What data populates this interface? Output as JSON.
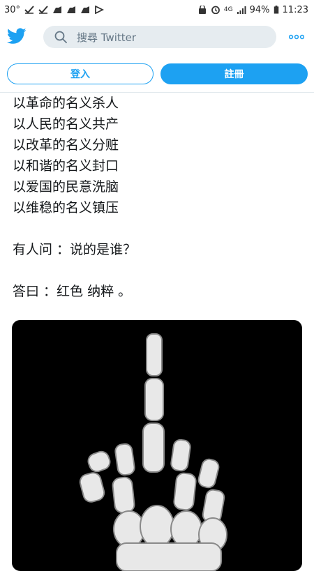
{
  "status_bar": {
    "temperature": "30°",
    "network": "4G",
    "battery": "94%",
    "time": "11:23"
  },
  "header": {
    "search_placeholder": "搜尋 Twitter",
    "logo_icon": "twitter-bird-icon",
    "more_icon": "more-dots-icon",
    "accent_color": "#1da1f2"
  },
  "auth": {
    "login_label": "登入",
    "signup_label": "註冊"
  },
  "tweet": {
    "lines": [
      "以革命的名义杀人",
      "以人民的名义共产",
      "以改革的名义分赃",
      "以和谐的名义封口",
      "以爱国的民意洗脑",
      "以维稳的名义镇压"
    ],
    "question": "有人问 ：说的是谁？",
    "answer": "答曰 ：红色 纳粹 。",
    "media_icon": "skeleton-middle-finger-image"
  }
}
